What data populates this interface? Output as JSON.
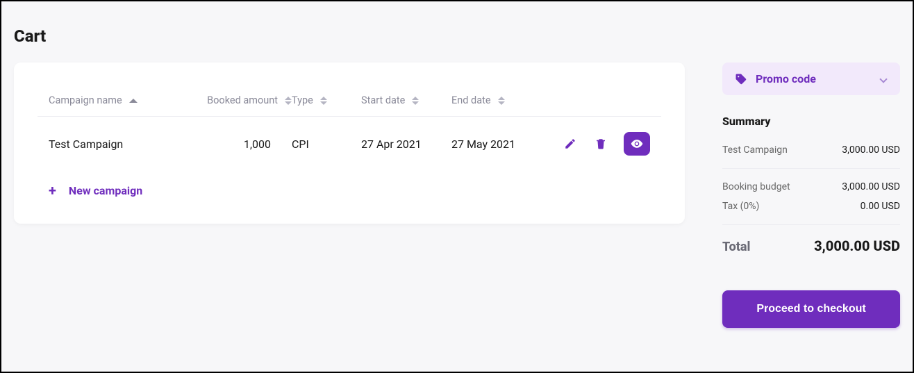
{
  "page": {
    "title": "Cart"
  },
  "table": {
    "columns": {
      "name": "Campaign name",
      "booked": "Booked amount",
      "type": "Type",
      "start": "Start date",
      "end": "End date"
    },
    "rows": [
      {
        "name": "Test Campaign",
        "booked": "1,000",
        "type": "CPI",
        "start": "27 Apr 2021",
        "end": "27 May 2021"
      }
    ],
    "new_campaign_label": "New campaign"
  },
  "promo": {
    "label": "Promo code"
  },
  "summary": {
    "title": "Summary",
    "items": [
      {
        "label": "Test Campaign",
        "value": "3,000.00 USD"
      }
    ],
    "budget": {
      "label": "Booking budget",
      "value": "3,000.00 USD"
    },
    "tax": {
      "label": "Tax (0%)",
      "value": "0.00 USD"
    },
    "total": {
      "label": "Total",
      "value": "3,000.00 USD"
    },
    "checkout_label": "Proceed to checkout"
  }
}
